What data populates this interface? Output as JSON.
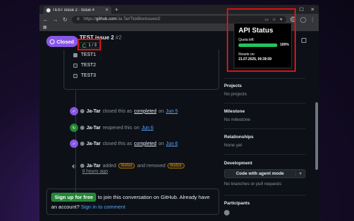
{
  "browser": {
    "tab_title": "TEST issue 2 · Issue #",
    "url_prefix": "https://",
    "url_host": "github.com",
    "url_path": "/Ja-Tar/TickBoxIssues/2",
    "window_minimize": "—",
    "window_maximize": "☐",
    "window_close": "✕"
  },
  "issue": {
    "state": "Closed",
    "title": "TEST issue 2",
    "number": "#2",
    "progress_text": "1 / 3"
  },
  "tasks": [
    {
      "label": "TEST1",
      "checked": true
    },
    {
      "label": "TEST2",
      "checked": false
    },
    {
      "label": "TEST3",
      "checked": false
    }
  ],
  "timeline": [
    {
      "actor": "Ja-Tar",
      "text": "closed this as",
      "link": "completed",
      "on": "on",
      "date": "Jun 5"
    },
    {
      "actor": "Ja-Tar",
      "text": "reopened this",
      "on": "on",
      "date": "Jun 6"
    },
    {
      "actor": "Ja-Tar",
      "text": "closed this as",
      "link": "completed",
      "on": "on",
      "date": "Jun 6"
    },
    {
      "actor": "Ja-Tar",
      "added": "added",
      "label_added": "firefox",
      "and_removed": "and removed",
      "label_removed": "firefox",
      "time": "8 hours ago"
    }
  ],
  "signup": {
    "button": "Sign up for free",
    "text": "to join this conversation on GitHub. Already have an account?",
    "sign_in": "Sign in to comment"
  },
  "sidebar": {
    "projects_head": "Projects",
    "projects_val": "No projects",
    "milestone_head": "Milestone",
    "milestone_val": "No milestone",
    "relationships_head": "Relationships",
    "relationships_val": "None yet",
    "development_head": "Development",
    "agent_button": "Code with agent mode",
    "development_val": "No branches or pull requests",
    "participants_head": "Participants"
  },
  "popup": {
    "title": "API Status",
    "quota_label": "Quota left:",
    "quota_percent": 100,
    "quota_text": "100%",
    "resets_label": "Resets on:",
    "resets_time": "21.07.2025, 00:39:59"
  }
}
